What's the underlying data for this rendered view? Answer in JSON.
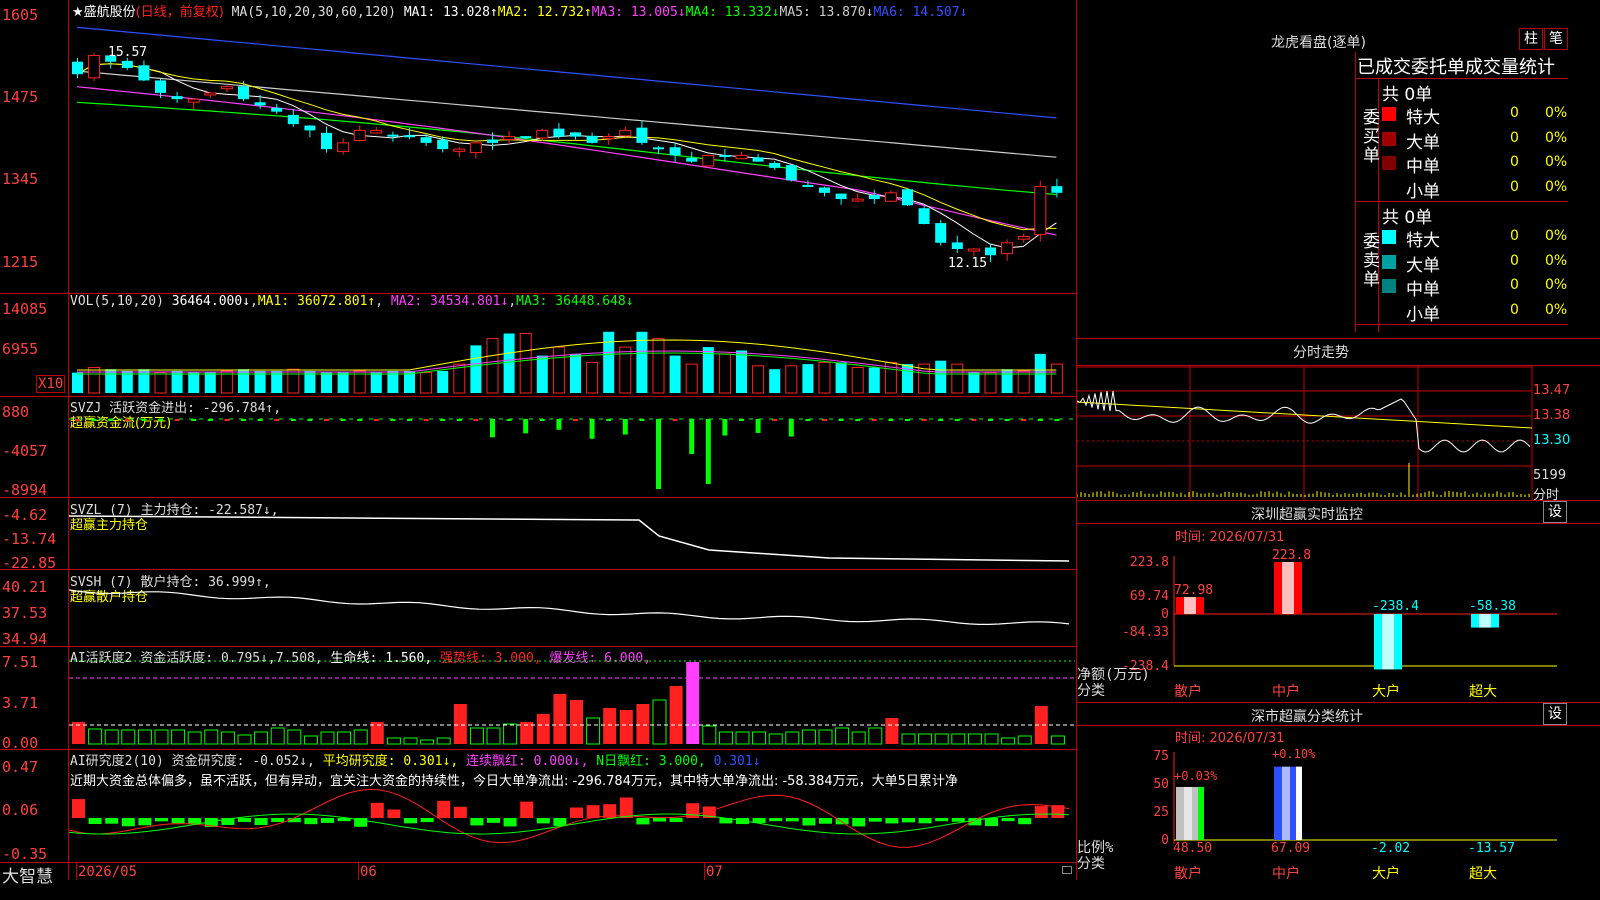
{
  "main_chart": {
    "stock_name": "★盛航股份",
    "mode": "(日线，前复权)",
    "ma_header": "MA(5,10,20,30,60,120)",
    "ma1": "MA1: 13.028↑",
    "ma2": "MA2: 12.732↑",
    "ma3": "MA3: 13.005↓",
    "ma4": "MA4: 13.332↓",
    "ma5": "MA5: 13.870↓",
    "ma6": "MA6: 14.507↓",
    "y_ticks": [
      "1605",
      "1475",
      "1345",
      "1215"
    ],
    "high_label": "15.57",
    "low_label": "12.15"
  },
  "vol_panel": {
    "header": "VOL(5,10,20)",
    "value": "36464.000↓",
    "ma1": "MA1: 36072.801↑",
    "ma2": "MA2: 34534.801↓",
    "ma3": "MA3: 36448.648↓",
    "y_ticks": [
      "14085",
      "6955"
    ],
    "unit": "X10"
  },
  "svzj_panel": {
    "header": "SVZJ  活跃资金进出: -296.784↑,",
    "subtitle": "超赢资金流(万元)",
    "y_ticks": [
      "880",
      "-4057",
      "-8994"
    ]
  },
  "svzl_panel": {
    "header": "SVZL (7) 主力持仓: -22.587↓,",
    "subtitle": "超赢主力持仓",
    "y_ticks": [
      "-4.62",
      "-13.74",
      "-22.85"
    ]
  },
  "svsh_panel": {
    "header": "SVSH (7) 散户持仓: 36.999↑,",
    "subtitle": "超赢散户持仓",
    "y_ticks": [
      "40.21",
      "37.53",
      "34.94"
    ]
  },
  "ai_active_panel": {
    "header_a": "AI活跃度2 资金活跃度: 0.795↓,7.508,",
    "header_b": "生命线: 1.560,",
    "header_c": "强势线: 3.000,",
    "header_d": "爆发线: 6.000,",
    "y_ticks": [
      "7.51",
      "3.71",
      "0.00"
    ]
  },
  "ai_research_panel": {
    "header_a": "AI研究度2(10) 资金研究度: -0.052↓,",
    "header_b": "平均研究度: 0.301↓,",
    "header_c": "连续飘红: 0.000↓,",
    "header_d": "N日飘红: 3.000,",
    "header_e": "0.301↓",
    "comment": "近期大资金总体偏多，虽不活跃，但有异动，宜关注大资金的持续性，今日大单净流出: -296.784万元，其中特大单净流出: -58.384万元，大单5日累计净",
    "y_ticks": [
      "0.47",
      "0.06",
      "-0.35"
    ]
  },
  "bottom_axis": {
    "brand": "大智慧",
    "labels": [
      "2026/05",
      "06",
      "07"
    ]
  },
  "right_panel": {
    "dragon_title": "龙虎看盘(逐单)",
    "btn_zhu": "柱",
    "btn_bi": "笔",
    "stats_title": "已成交委托单成交量统计",
    "buy_label": "委买单",
    "sell_label": "委卖单",
    "buy_total": "共 0单",
    "sell_total": "共 0单",
    "rows": [
      {
        "name": "特大",
        "count": "0",
        "pct": "0%"
      },
      {
        "name": "大单",
        "count": "0",
        "pct": "0%"
      },
      {
        "name": "中单",
        "count": "0",
        "pct": "0%"
      },
      {
        "name": "小单",
        "count": "0",
        "pct": "0%"
      }
    ],
    "buy_colors": [
      "#ff0000",
      "#a00000",
      "#800000",
      "#000000"
    ],
    "sell_colors": [
      "#00ffff",
      "#00a0a0",
      "#008080",
      "#000000"
    ],
    "intraday_title": "分时走势",
    "intraday_ticks": [
      "13.47",
      "13.38",
      "13.30"
    ],
    "intraday_vol": "5199",
    "intraday_vol_label": "分时",
    "monitor_title": "深圳超赢实时监控",
    "monitor_set": "设",
    "monitor_time": "时间: 2026/07/31",
    "monitor_ticks": [
      "223.8",
      "69.74",
      "0",
      "-84.33",
      "-238.4"
    ],
    "monitor_axis_unit": "净额(万元)",
    "monitor_axis_cat": "分类",
    "monitor_bars": [
      {
        "cat": "散户",
        "value": "72.98"
      },
      {
        "cat": "中户",
        "value": "223.8"
      },
      {
        "cat": "大户",
        "value": "-238.4"
      },
      {
        "cat": "超大",
        "value": "-58.38"
      }
    ],
    "classify_title": "深市超赢分类统计",
    "classify_set": "设",
    "classify_time": "时间: 2026/07/31",
    "classify_ticks": [
      "75",
      "50",
      "25",
      "0"
    ],
    "classify_axis_unit": "比例%",
    "classify_axis_cat": "分类",
    "classify_top": [
      "+0.03%",
      "+0.10%"
    ],
    "classify_bars": [
      {
        "cat": "散户",
        "value": "48.50"
      },
      {
        "cat": "中户",
        "value": "67.09"
      },
      {
        "cat": "大户",
        "value": "-2.02"
      },
      {
        "cat": "超大",
        "value": "-13.57"
      }
    ]
  },
  "colors": {
    "up": "#ff2020",
    "down": "#00ffff",
    "grid": "#c00000",
    "yellow": "#ffff00",
    "magenta": "#ff40ff",
    "green": "#00ff00"
  }
}
